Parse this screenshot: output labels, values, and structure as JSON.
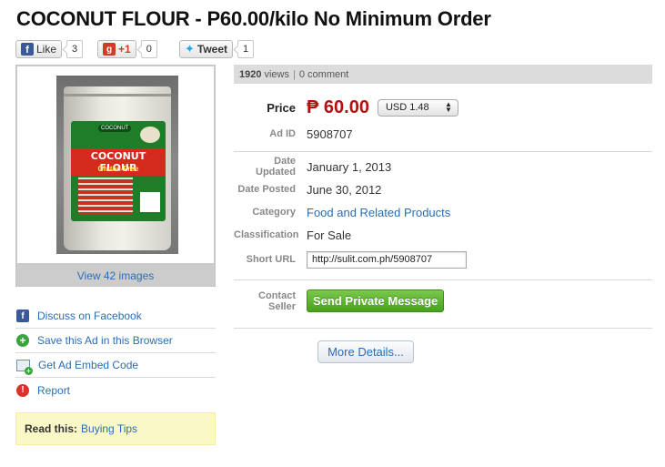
{
  "title": "COCONUT FLOUR - P60.00/kilo No Minimum Order",
  "social": {
    "like_label": "Like",
    "like_count": "3",
    "gplus_label": "+1",
    "gplus_count": "0",
    "tweet_label": "Tweet",
    "tweet_count": "1"
  },
  "gallery": {
    "view_images": "View 42 images",
    "package": {
      "brand": "COCONUT",
      "name": "COCONUT FLOUR",
      "subtitle": "Gluten-Free"
    }
  },
  "left_links": [
    {
      "label": "Discuss on Facebook",
      "icon": "facebook-icon"
    },
    {
      "label": "Save this Ad in this Browser",
      "icon": "save-plus-icon"
    },
    {
      "label": "Get Ad Embed Code",
      "icon": "embed-code-icon"
    },
    {
      "label": "Report",
      "icon": "report-alert-icon"
    }
  ],
  "tips": {
    "label": "Read this:",
    "link": "Buying Tips"
  },
  "stats": {
    "views": "1920",
    "views_suffix": "views",
    "separator": "|",
    "comments": "0 comment"
  },
  "price": {
    "label": "Price",
    "value": "₱ 60.00",
    "currency_selected": "USD 1.48"
  },
  "details": {
    "ad_id_label": "Ad ID",
    "ad_id": "5908707",
    "date_updated_label": "Date Updated",
    "date_updated": "January 1, 2013",
    "date_posted_label": "Date Posted",
    "date_posted": "June 30, 2012",
    "category_label": "Category",
    "category": "Food and Related Products",
    "classification_label": "Classification",
    "classification": "For Sale",
    "short_url_label": "Short URL",
    "short_url": "http://sulit.com.ph/5908707",
    "contact_label": "Contact Seller"
  },
  "actions": {
    "send_message": "Send Private Message",
    "more_details": "More Details..."
  },
  "colors": {
    "price_red": "#b50f10",
    "link_blue": "#2a6db5",
    "button_green": "#47a21d",
    "tips_bg": "#fbf8c8"
  }
}
